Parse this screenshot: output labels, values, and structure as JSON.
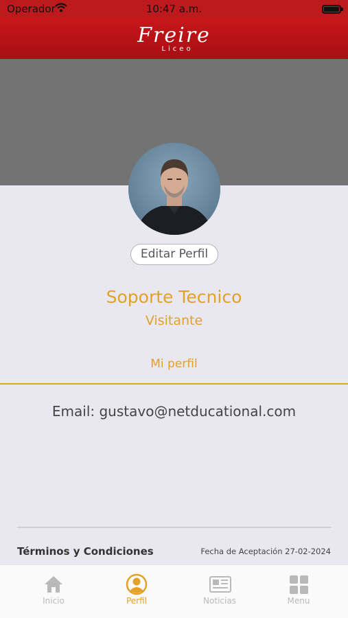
{
  "statusbar": {
    "carrier": "Operador",
    "time": "10:47 a.m."
  },
  "header": {
    "logo": "Freire",
    "logo_sub": "Liceo"
  },
  "profile": {
    "edit_label": "Editar Perfil",
    "name": "Soporte Tecnico",
    "role": "Visitante",
    "tab_label": "Mi perfil",
    "email": "Email: gustavo@netducational.com"
  },
  "footer": {
    "terms_label": "Términos y Condiciones",
    "accept_date": "Fecha de Aceptación 27-02-2024"
  },
  "tabbar": {
    "items": [
      {
        "label": "Inicio",
        "icon": "home-icon"
      },
      {
        "label": "Perfil",
        "icon": "profile-icon"
      },
      {
        "label": "Noticias",
        "icon": "newspaper-icon"
      },
      {
        "label": "Menu",
        "icon": "grid-icon"
      }
    ],
    "active": "Perfil"
  },
  "colors": {
    "brand_red": "#bd1a1e",
    "accent": "#e3a126",
    "cover_gray": "#737373",
    "background": "#e9e7ef"
  }
}
